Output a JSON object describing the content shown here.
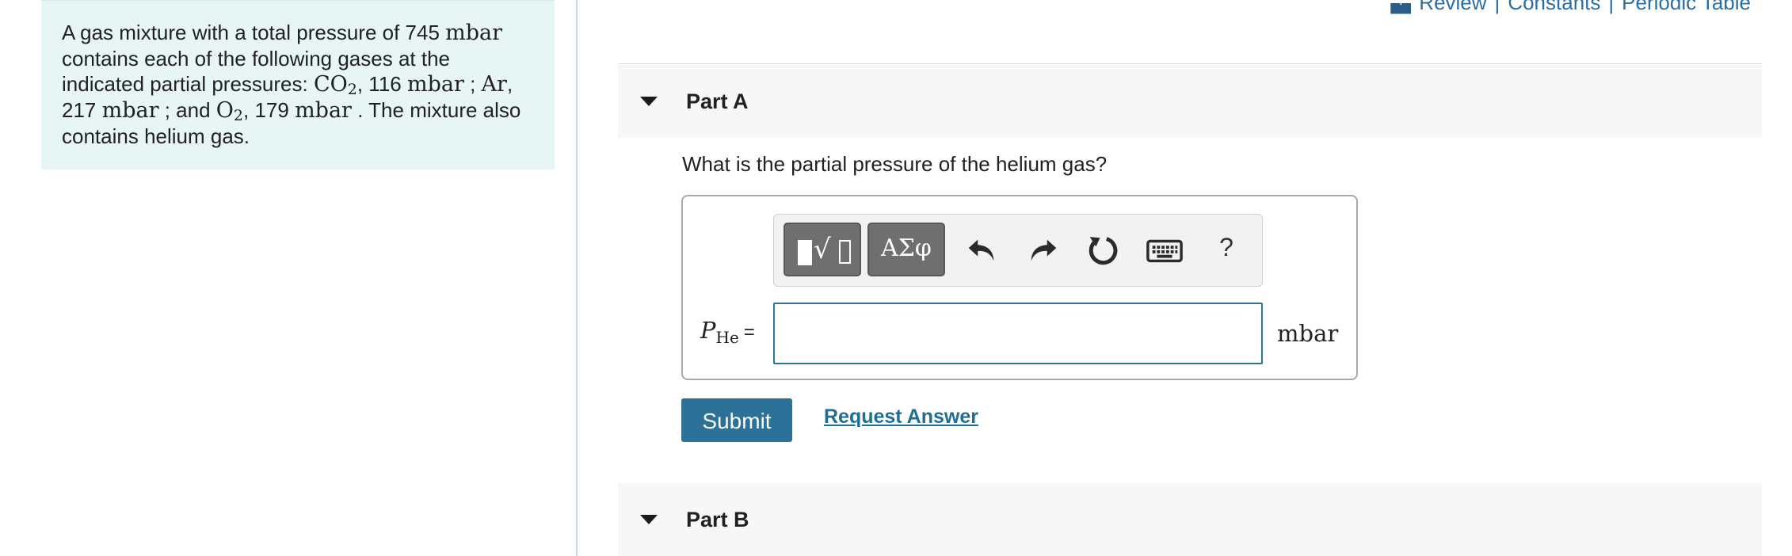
{
  "problem": {
    "t1": "A gas mixture with a total pressure of 745 ",
    "unit1": "mbar",
    "t2": " contains each of the following gases at the indicated partial pressures: ",
    "co2_a": "CO",
    "co2_sub": "2",
    "co2_b": ", 116 ",
    "unit2": "mbar",
    "t3": " ; ",
    "ar": "Ar",
    "t4": ", 217 ",
    "unit3": "mbar",
    "t5": " ; and ",
    "o2_a": "O",
    "o2_sub": "2",
    "o2_b": ", 179 ",
    "unit4": "mbar",
    "t6": " . The mixture also contains helium gas."
  },
  "header_links": {
    "review": "Review",
    "sep1": "|",
    "constants": "Constants",
    "sep2": "|",
    "periodic": "Periodic Table"
  },
  "partA": {
    "title": "Part A",
    "question": "What is the partial pressure of the helium gas?",
    "toolbar": {
      "greek": "ΑΣφ",
      "help": "?"
    },
    "variable_symbol": "P",
    "variable_subscript": "He",
    "equals": "=",
    "answer_value": "",
    "unit": "mbar",
    "submit": "Submit",
    "request_answer": "Request Answer"
  },
  "partB": {
    "title": "Part B"
  },
  "icons": {
    "book": "book-icon",
    "templates": "templates-icon",
    "undo": "undo-icon",
    "redo": "redo-icon",
    "reset": "reset-icon",
    "keyboard": "keyboard-icon",
    "caret": "caret-down-icon"
  },
  "colors": {
    "problem_bg": "#e8f5f5",
    "accent": "#2c7197",
    "link": "#2a6ea8"
  }
}
